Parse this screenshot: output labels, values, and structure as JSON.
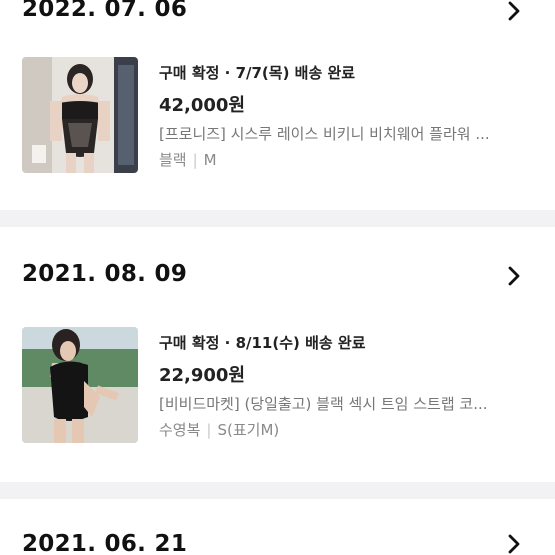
{
  "orders": [
    {
      "date": "2022. 07. 06",
      "status": "구매 확정 · 7/7(목) 배송 완료",
      "price": "42,000원",
      "title": "[프로니즈] 시스루 레이스 비키니 비치웨어 플라워 ...",
      "option_color": "블랙",
      "option_size": "M"
    },
    {
      "date": "2021. 08. 09",
      "status": "구매 확정 · 8/11(수) 배송 완료",
      "price": "22,900원",
      "title": "[비비드마켓] (당일출고) 블랙 섹시 트임 스트랩 코...",
      "option_color": "수영복",
      "option_size": "S(표기M)"
    },
    {
      "date": "2021. 06. 21"
    }
  ],
  "icons": {
    "chevron": "chevron-right-icon"
  }
}
